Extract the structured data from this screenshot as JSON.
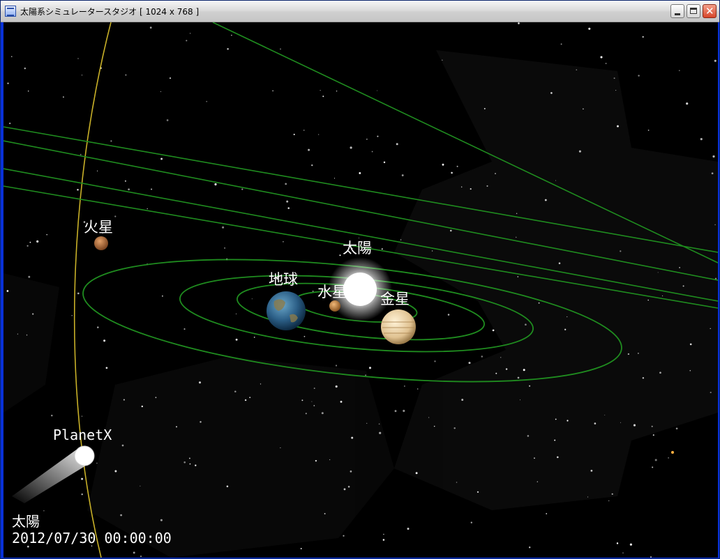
{
  "window": {
    "title": "太陽系シミュレータースタジオ [ 1024 x 768 ]",
    "app_icon": "app-window-icon",
    "controls": {
      "minimize_icon": "minimize-icon",
      "maximize_icon": "maximize-icon",
      "close_icon": "close-icon",
      "close_glyph": "✕"
    }
  },
  "scene": {
    "background": "#000000",
    "orbit_color": "#1f8c1f",
    "outer_orbit_color": "#c8b028",
    "labels": {
      "sun": "太陽",
      "earth": "地球",
      "mercury": "水星",
      "venus": "金星",
      "mars": "火星",
      "planet_x": "PlanetX"
    }
  },
  "status": {
    "focus_target": "太陽",
    "datetime": "2012/07/30 00:00:00"
  }
}
